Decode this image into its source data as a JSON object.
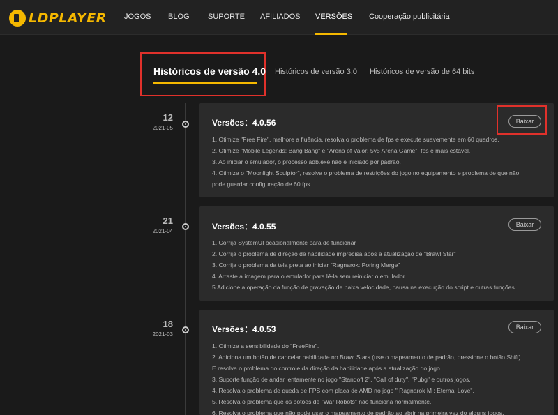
{
  "brand": {
    "name": "LDPLAYER"
  },
  "nav": {
    "items": [
      "JOGOS",
      "BLOG",
      "SUPORTE",
      "AFILIADOS",
      "VERSÕES",
      "Cooperação publicitária"
    ],
    "active": "VERSÕES"
  },
  "tabs": [
    {
      "label": "Históricos de versão 4.0",
      "active": true
    },
    {
      "label": "Históricos de versão 3.0",
      "active": false
    },
    {
      "label": "Históricos de versão de 64 bits",
      "active": false
    }
  ],
  "releases": [
    {
      "day": "12",
      "month": "2021-05",
      "title": "Versões：4.0.56",
      "button": "Baixar",
      "notes": [
        "1. Otimize \"Free Fire\", melhore a fluência, resolva o problema de fps e execute suavemente em 60 quadros.",
        "2. Otimize \"Mobile Legends: Bang Bang\" e \"Arena of Valor: 5v5 Arena Game\", fps é mais estável.",
        "3. Ao iniciar o emulador, o processo adb.exe não é iniciado por padrão.",
        "4. Otimize o \"Moonlight Sculptor\", resolva o problema de restrições do jogo no equipamento e problema de que não",
        "pode guardar configuração de 60 fps."
      ]
    },
    {
      "day": "21",
      "month": "2021-04",
      "title": "Versões：4.0.55",
      "button": "Baixar",
      "notes": [
        "1. Corrija SystemUI ocasionalmente para de funcionar",
        "2. Corrija o problema de direção de habilidade imprecisa após a atualização de \"Brawl Star\"",
        "3. Corrija o problema da tela preta ao iniciar \"Ragnarok: Poring Merge\"",
        "4. Arraste a imagem para o emulador para lê-la sem reiniciar o emulador.",
        "5.Adicione a operação da função de gravação de baixa velocidade, pausa na execução do script e outras funções."
      ]
    },
    {
      "day": "18",
      "month": "2021-03",
      "title": "Versões：4.0.53",
      "button": "Baixar",
      "notes": [
        "1. Otimize a sensibilidade do \"FreeFire\".",
        "2. Adiciona um botão de cancelar habilidade no Brawl Stars (use o mapeamento de padrão, pressione o botão Shift).",
        "E resolva o problema do controle da direção da habilidade após a atualização do jogo.",
        "3. Suporte função de andar lentamente no jogo \"Standoff 2\", \"Call of duty\", \"Pubg\" e outros jogos.",
        "4. Resolva o problema de queda de FPS com placa de AMD no jogo \" Ragnarok M : Eternal Love\".",
        "5. Resolva o problema que os botões de \"War Robots\" não funciona normalmente.",
        "6. Resolva o problema que não pode usar o mapeamento de padrão ao abrir na primeira vez do alguns jogos."
      ]
    }
  ],
  "colors": {
    "accent": "#f5b800",
    "highlight": "#e0312b",
    "background": "#1a1a1a",
    "card": "#2b2b2b"
  }
}
